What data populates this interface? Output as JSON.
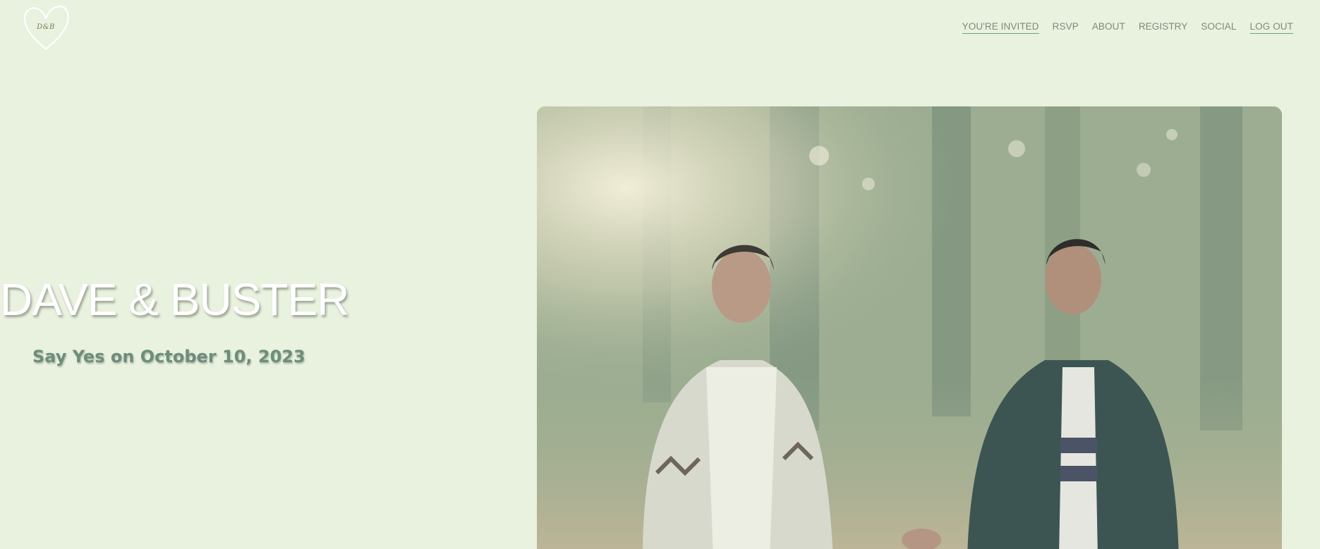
{
  "logo": {
    "initials": "D&B"
  },
  "nav": {
    "items": [
      {
        "label": "YOU'RE INVITED",
        "active": true
      },
      {
        "label": "RSVP",
        "active": false
      },
      {
        "label": "ABOUT",
        "active": false
      },
      {
        "label": "REGISTRY",
        "active": false
      },
      {
        "label": "SOCIAL",
        "active": false
      },
      {
        "label": "LOG OUT",
        "active": true
      }
    ]
  },
  "hero": {
    "title": "DAVE & BUSTER",
    "subtitle": "Say Yes on October 10, 2023"
  },
  "colors": {
    "background": "#e9f1df",
    "accent": "#6fa08a",
    "subtitle": "#6c8e7a",
    "nav_text": "#7f8a7c"
  }
}
